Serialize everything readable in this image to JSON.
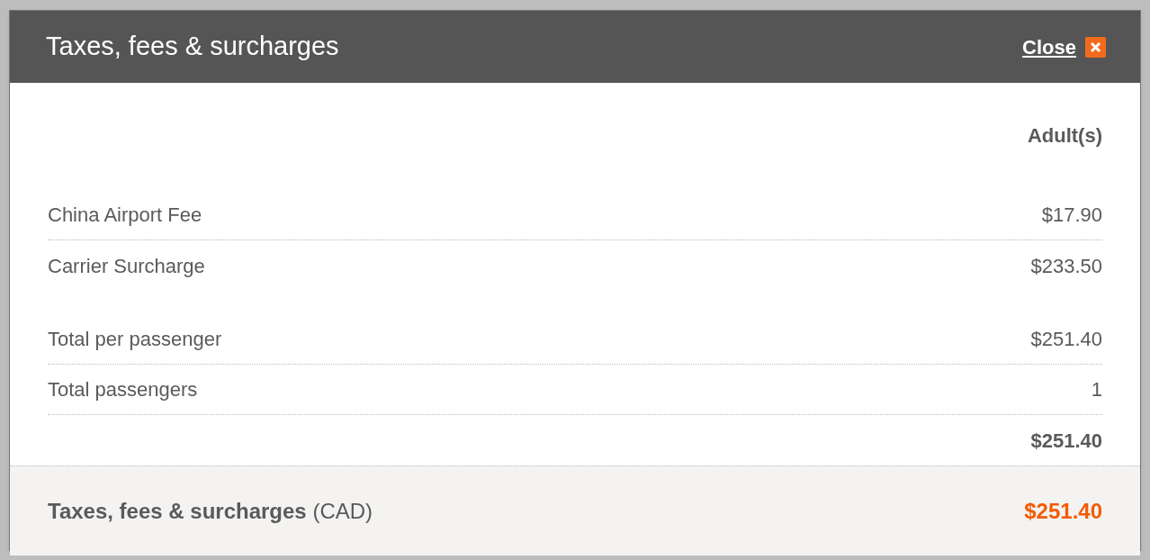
{
  "dialog": {
    "title": "Taxes, fees & surcharges",
    "close_label": "Close",
    "column_header": "Adult(s)",
    "fees": [
      {
        "label": "China Airport Fee",
        "amount": "$17.90"
      },
      {
        "label": "Carrier Surcharge",
        "amount": "$233.50"
      }
    ],
    "totals": [
      {
        "label": "Total per passenger",
        "value": "$251.40"
      },
      {
        "label": "Total passengers",
        "value": "1"
      }
    ],
    "subtotal": "$251.40",
    "footer": {
      "label": "Taxes, fees & surcharges",
      "currency": "(CAD)",
      "amount": "$251.40"
    }
  }
}
